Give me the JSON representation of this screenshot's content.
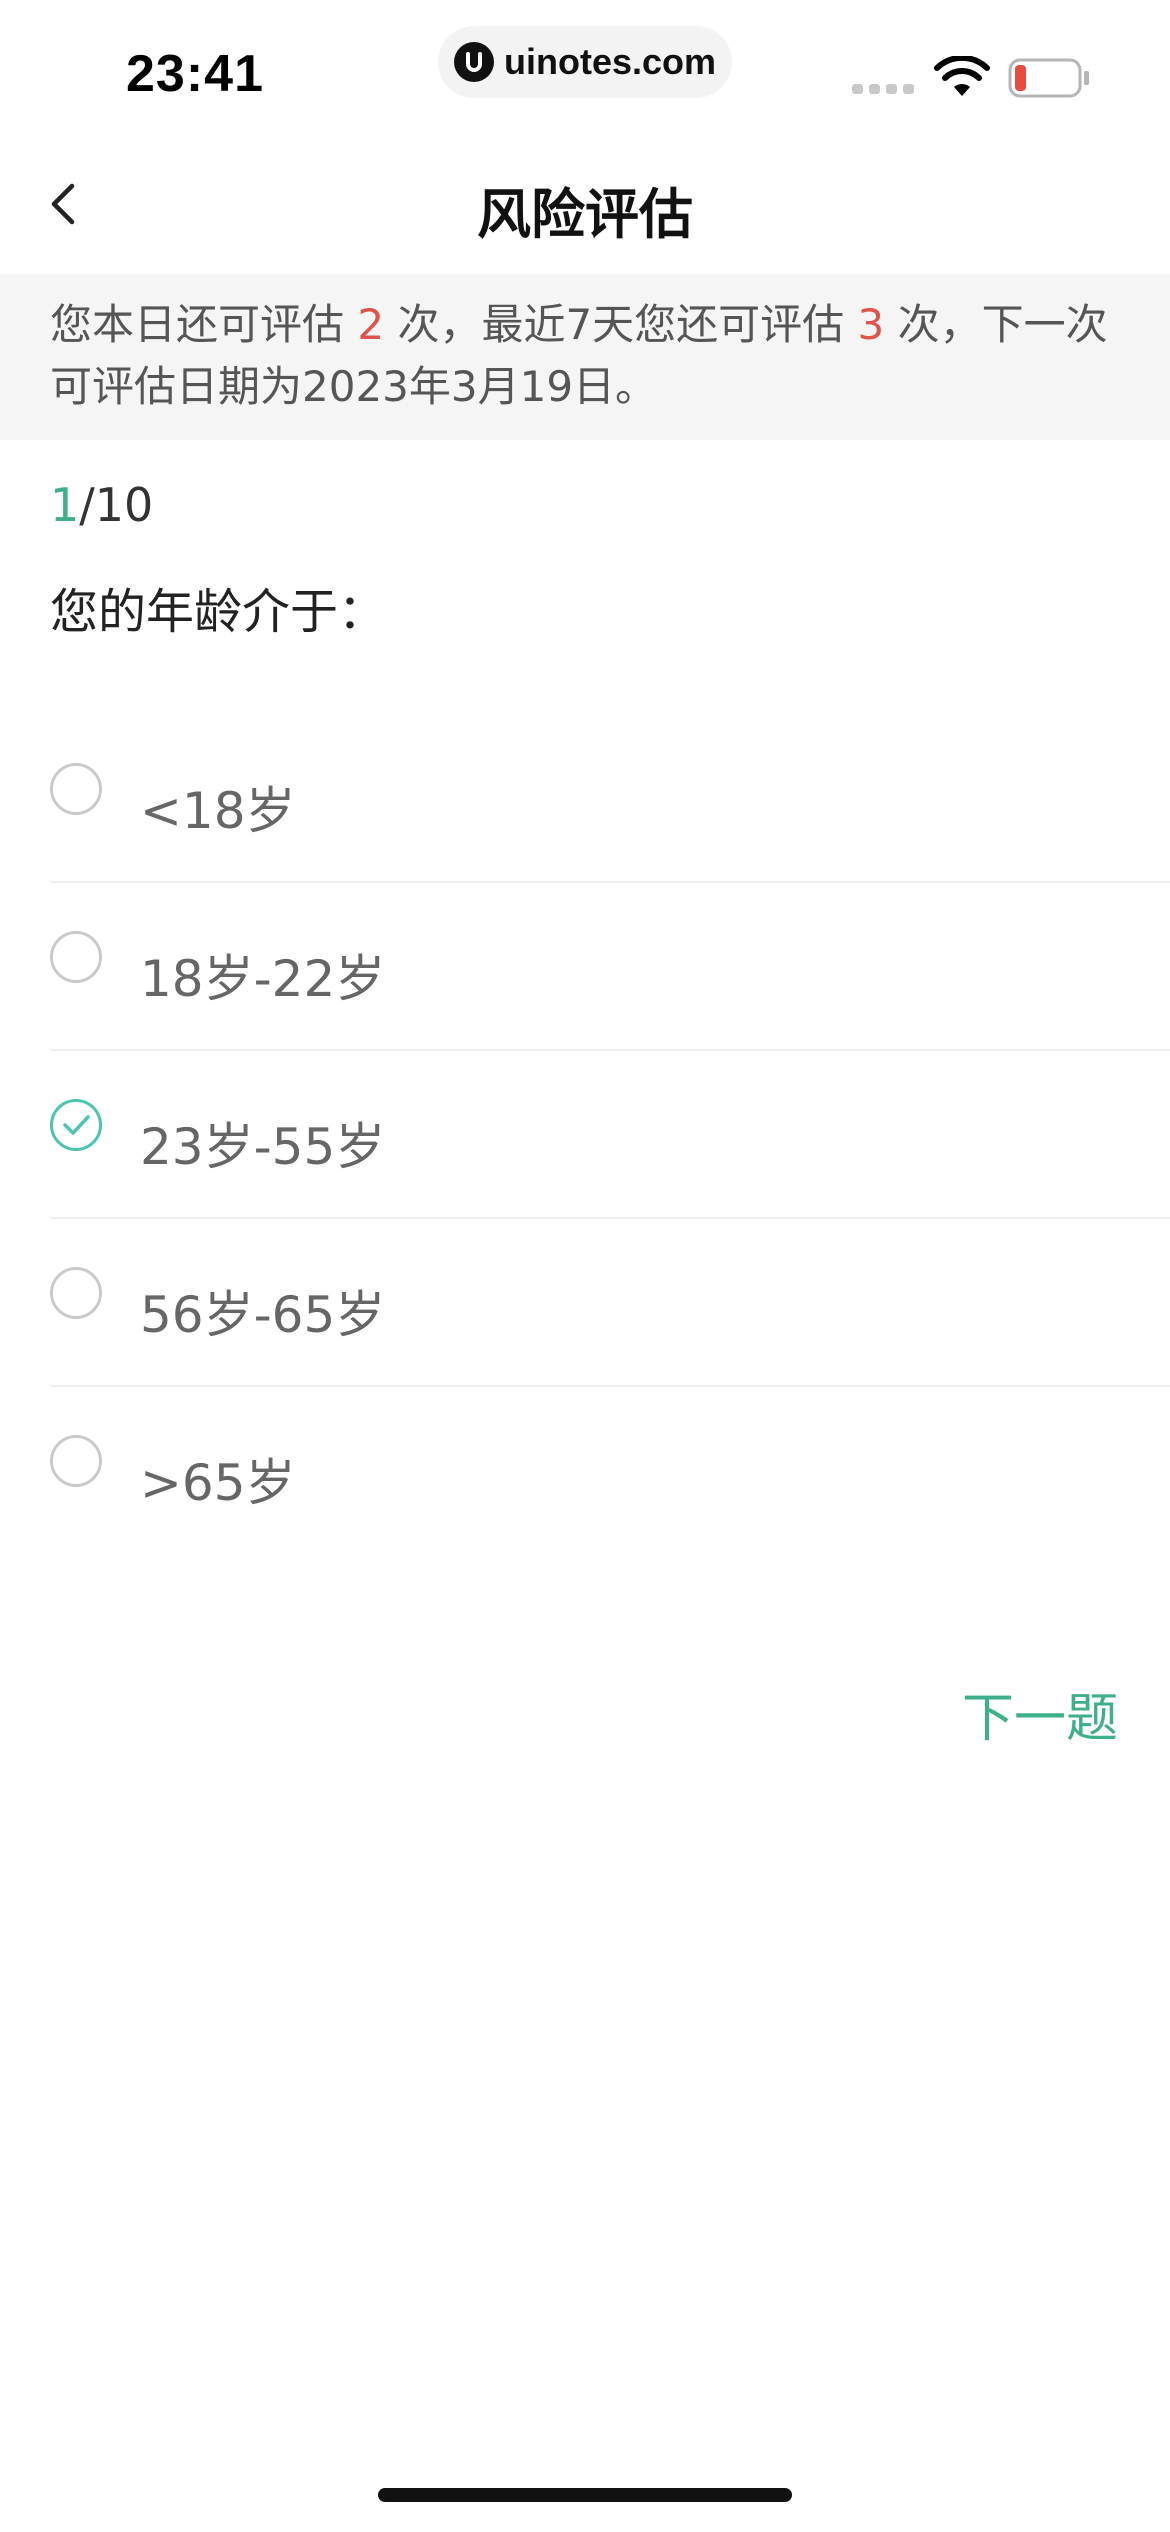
{
  "status_bar": {
    "time": "23:41",
    "url": "uinotes.com",
    "icons": [
      "signal-icon",
      "wifi-icon",
      "battery-low-icon"
    ],
    "battery_color": "#e74c3c"
  },
  "nav": {
    "title": "风险评估",
    "back_icon": "chevron-left-icon"
  },
  "notice": {
    "text_1": "您本日还可评估 ",
    "today_count": "2",
    "text_2": " 次，最近7天您还可评估 ",
    "week_count": "3",
    "text_3": " 次，下一次可评估日期为2023年3月19日。",
    "highlight_color": "#e0534a"
  },
  "question": {
    "current": "1",
    "total": "/10",
    "text": "您的年龄介于：",
    "options": [
      {
        "label": "<18岁",
        "selected": false
      },
      {
        "label": "18岁-22岁",
        "selected": false
      },
      {
        "label": "23岁-55岁",
        "selected": true
      },
      {
        "label": "56岁-65岁",
        "selected": false
      },
      {
        "label": ">65岁",
        "selected": false
      }
    ]
  },
  "actions": {
    "next_label": "下一题"
  },
  "colors": {
    "accent": "#3db08b",
    "checked": "#4cc4b0"
  }
}
